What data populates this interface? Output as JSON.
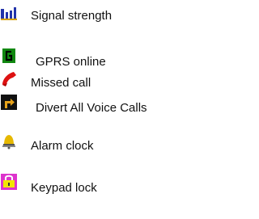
{
  "legend": {
    "items": [
      {
        "icon": "signal-strength-icon",
        "label": "Signal strength"
      },
      {
        "icon": "gprs-online-icon",
        "label": "GPRS online"
      },
      {
        "icon": "missed-call-icon",
        "label": "Missed call"
      },
      {
        "icon": "divert-calls-icon",
        "label": "Divert All Voice Calls"
      },
      {
        "icon": "alarm-clock-icon",
        "label": "Alarm clock"
      },
      {
        "icon": "keypad-lock-icon",
        "label": "Keypad lock"
      }
    ]
  },
  "colors": {
    "signal": "#2233aa",
    "gprs": "#118811",
    "missed_call": "#dd1111",
    "divert": "#e6a21a",
    "alarm": "#e6b800",
    "keypad": "#dd33cc"
  }
}
